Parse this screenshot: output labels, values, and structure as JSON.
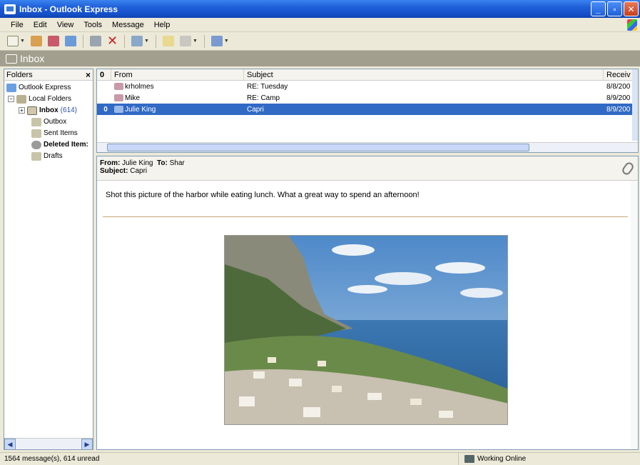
{
  "window": {
    "title": "Inbox - Outlook Express"
  },
  "menu": [
    "File",
    "Edit",
    "View",
    "Tools",
    "Message",
    "Help"
  ],
  "folder_band": {
    "title": "Inbox"
  },
  "folders": {
    "header": "Folders",
    "root": "Outlook Express",
    "local": "Local Folders",
    "inbox": "Inbox",
    "inbox_count": "(614)",
    "outbox": "Outbox",
    "sent": "Sent Items",
    "deleted": "Deleted Item:",
    "drafts": "Drafts"
  },
  "list": {
    "columns": {
      "attach": "0",
      "from": "From",
      "subject": "Subject",
      "received": "Receiv"
    },
    "rows": [
      {
        "attach": "",
        "from": "krholmes",
        "subject": "RE: Tuesday",
        "received": "8/8/200"
      },
      {
        "attach": "",
        "from": "Mike",
        "subject": "RE: Camp",
        "received": "8/9/200"
      },
      {
        "attach": "0",
        "from": "Julie King",
        "subject": "Capri",
        "received": "8/9/200"
      }
    ]
  },
  "preview": {
    "from_label": "From:",
    "from": "Julie King",
    "to_label": "To:",
    "to": "Shar",
    "subject_label": "Subject:",
    "subject": "Capri",
    "body": "Shot this picture of the harbor while eating lunch. What a great way to spend an afternoon!"
  },
  "status": {
    "messages": "1564 message(s), 614 unread",
    "connection": "Working Online"
  }
}
